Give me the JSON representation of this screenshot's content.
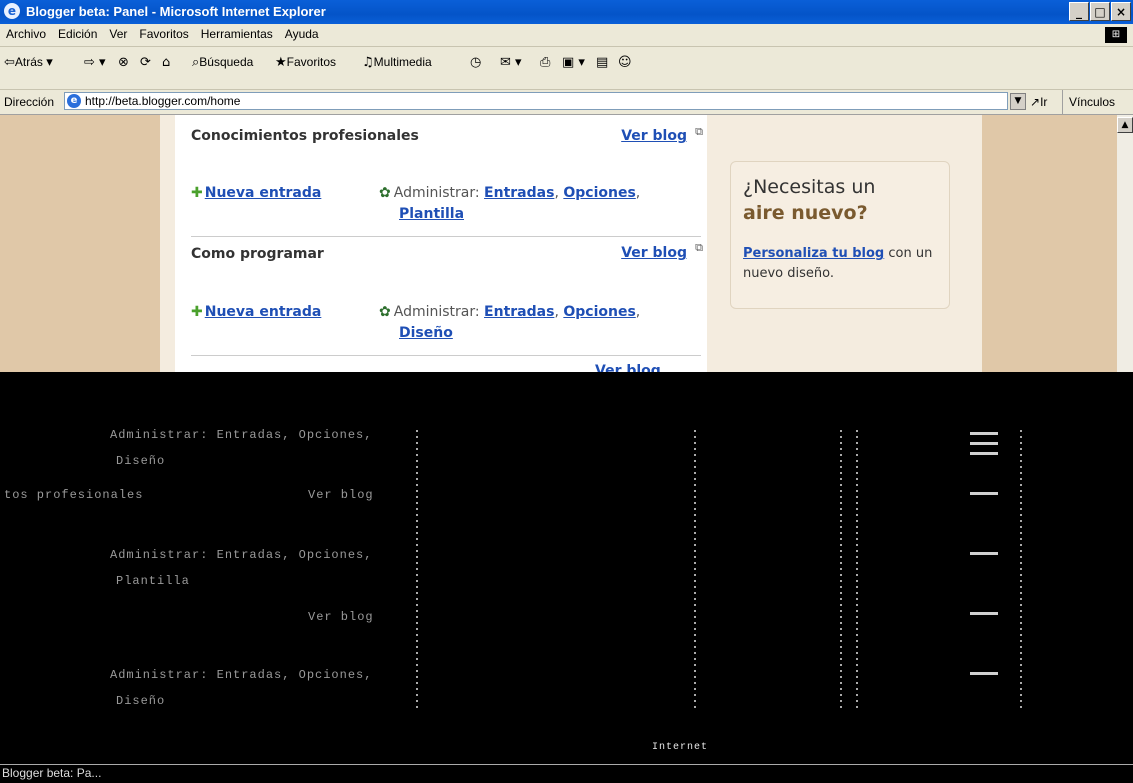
{
  "window": {
    "title": "Blogger beta: Panel - Microsoft Internet Explorer",
    "min": "_",
    "max": "□",
    "close": "×"
  },
  "menu": [
    "Archivo",
    "Edición",
    "Ver",
    "Favoritos",
    "Herramientas",
    "Ayuda"
  ],
  "toolbar": {
    "back": "Atrás",
    "search": "Búsqueda",
    "favorites": "Favoritos",
    "media": "Multimedia"
  },
  "address": {
    "label": "Dirección",
    "url": "http://beta.blogger.com/home",
    "go": "Ir",
    "links": "Vínculos"
  },
  "blogs": [
    {
      "name": "Conocimientos profesionales",
      "view": "Ver blog",
      "new_post": "Nueva entrada",
      "admin_label": "Administrar:",
      "admin_links": [
        "Entradas",
        "Opciones",
        "Plantilla"
      ]
    },
    {
      "name": "Como programar",
      "view": "Ver blog",
      "new_post": "Nueva entrada",
      "admin_label": "Administrar:",
      "admin_links": [
        "Entradas",
        "Opciones",
        "Diseño"
      ]
    }
  ],
  "partial_blog": {
    "view": "Ver blog"
  },
  "promo": {
    "line1": "¿Necesitas un",
    "line2": "aire nuevo?",
    "link": "Personaliza tu blog",
    "rest": " con un nuevo diseño."
  },
  "garbled": {
    "row1_admin": "Administrar: Entradas, Opciones,",
    "row1_sub": "Diseño",
    "row2_name": "tos profesionales",
    "row2_view": "Ver blog",
    "row3_admin": "Administrar: Entradas, Opciones,",
    "row3_sub": "Plantilla",
    "row4_view": "Ver blog",
    "row5_admin": "Administrar: Entradas, Opciones,",
    "row5_sub": "Diseño",
    "zone": "Internet",
    "status": "Blogger beta: Pa..."
  }
}
